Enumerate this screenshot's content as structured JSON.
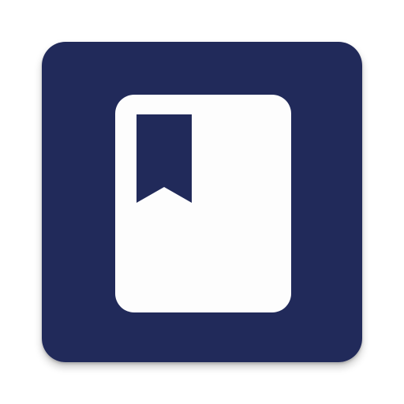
{
  "icon": {
    "name": "bookmark-book-app-icon",
    "symbol": "book-with-bookmark-icon",
    "colors": {
      "background": "#212A5A",
      "page": "#FDFDFD",
      "bookmark": "#212A5A"
    }
  }
}
